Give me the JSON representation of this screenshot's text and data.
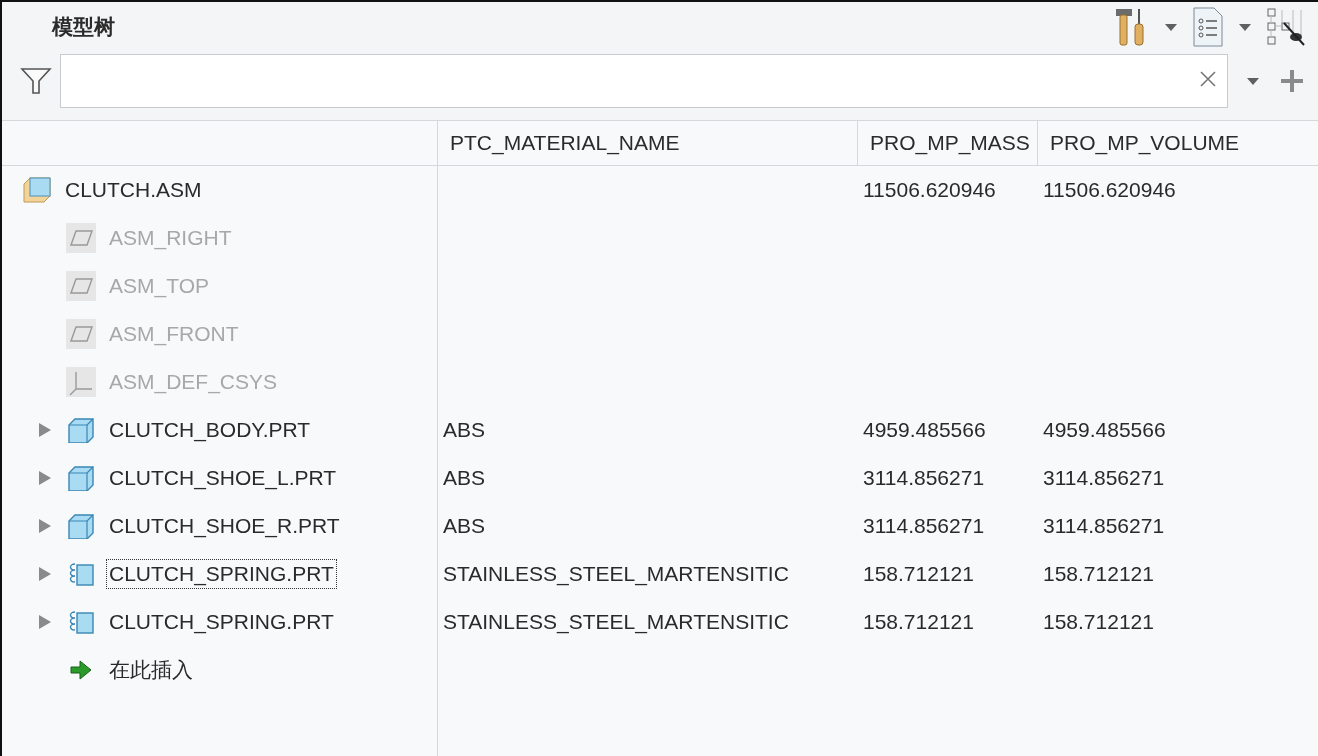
{
  "panel": {
    "title": "模型树"
  },
  "table": {
    "columns": [
      "PTC_MATERIAL_NAME",
      "PRO_MP_MASS",
      "PRO_MP_VOLUME"
    ],
    "rows": [
      {
        "name": "CLUTCH.ASM",
        "kind": "assembly",
        "disabled": false,
        "expandable": false,
        "focused": false,
        "mass": "11506.620946",
        "volume": "11506.620946",
        "children": [
          {
            "name": "ASM_RIGHT",
            "kind": "plane",
            "disabled": true,
            "expandable": false,
            "focused": false
          },
          {
            "name": "ASM_TOP",
            "kind": "plane",
            "disabled": true,
            "expandable": false,
            "focused": false
          },
          {
            "name": "ASM_FRONT",
            "kind": "plane",
            "disabled": true,
            "expandable": false,
            "focused": false
          },
          {
            "name": "ASM_DEF_CSYS",
            "kind": "csys",
            "disabled": true,
            "expandable": false,
            "focused": false
          },
          {
            "name": "CLUTCH_BODY.PRT",
            "kind": "part",
            "disabled": false,
            "expandable": true,
            "focused": false,
            "material": "ABS",
            "mass": "4959.485566",
            "volume": "4959.485566"
          },
          {
            "name": "CLUTCH_SHOE_L.PRT",
            "kind": "part",
            "disabled": false,
            "expandable": true,
            "focused": false,
            "material": "ABS",
            "mass": "3114.856271",
            "volume": "3114.856271"
          },
          {
            "name": "CLUTCH_SHOE_R.PRT",
            "kind": "part",
            "disabled": false,
            "expandable": true,
            "focused": false,
            "material": "ABS",
            "mass": "3114.856271",
            "volume": "3114.856271"
          },
          {
            "name": "CLUTCH_SPRING.PRT",
            "kind": "spring",
            "disabled": false,
            "expandable": true,
            "focused": true,
            "material": "STAINLESS_STEEL_MARTENSITIC",
            "mass": "158.712121",
            "volume": "158.712121"
          },
          {
            "name": "CLUTCH_SPRING.PRT",
            "kind": "spring",
            "disabled": false,
            "expandable": true,
            "focused": false,
            "material": "STAINLESS_STEEL_MARTENSITIC",
            "mass": "158.712121",
            "volume": "158.712121"
          },
          {
            "name": "在此插入",
            "kind": "insert",
            "disabled": false,
            "expandable": false,
            "focused": false
          }
        ]
      }
    ]
  }
}
